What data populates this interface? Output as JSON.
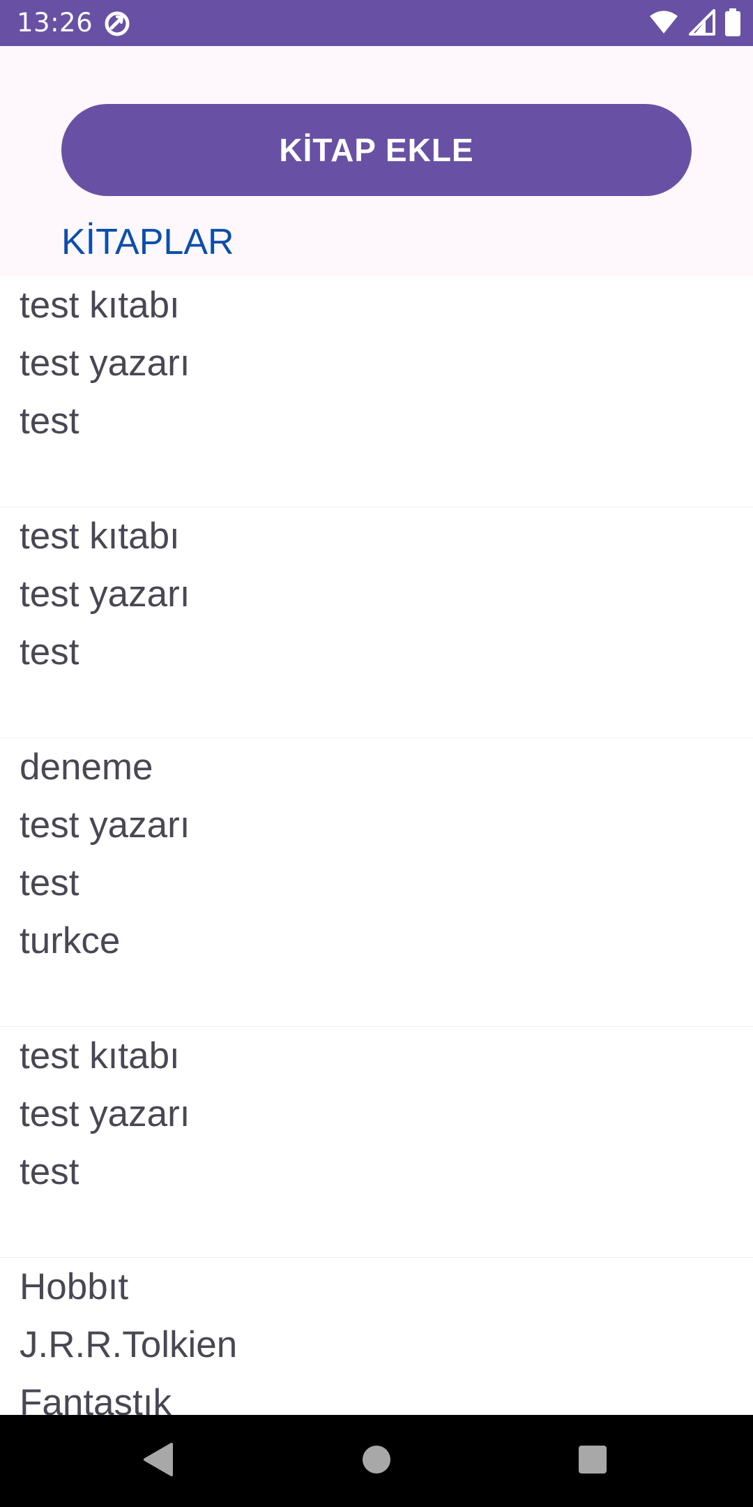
{
  "status_bar": {
    "time": "13:26",
    "app_icon": "sync-app-icon",
    "icons": [
      "wifi-icon",
      "signal-icon",
      "battery-icon"
    ],
    "color": "#6851a4"
  },
  "header": {
    "add_button_label": "KİTAP EKLE",
    "section_title": "KİTAPLAR",
    "title_color": "#0b4fa9"
  },
  "books": [
    {
      "lines": [
        "test kıtabı",
        "test yazarı",
        "test"
      ]
    },
    {
      "lines": [
        "test kıtabı",
        "test yazarı",
        "test"
      ]
    },
    {
      "lines": [
        "deneme",
        "test yazarı",
        "test",
        "turkce"
      ]
    },
    {
      "lines": [
        "test kıtabı",
        "test yazarı",
        "test"
      ]
    },
    {
      "lines": [
        "Hobbıt",
        "J.R.R.Tolkien",
        "Fantastık"
      ]
    }
  ],
  "nav_bar": {
    "buttons": [
      "back-icon",
      "home-icon",
      "recents-icon"
    ]
  }
}
